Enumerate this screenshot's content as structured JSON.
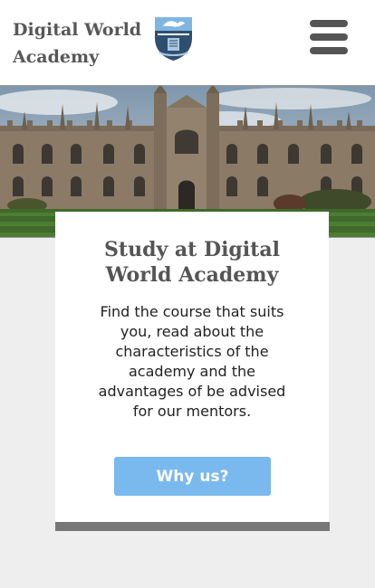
{
  "header": {
    "brand_name": "Digital World Academy",
    "logo_icon": "academy-crest-icon",
    "menu_icon": "hamburger-menu-icon"
  },
  "hero": {
    "image": "college-building-photo"
  },
  "card": {
    "title": "Study at Digital World Academy",
    "text": "Find the course that suits you, read about the characteristics of the academy and the advantages of be advised for our mentors.",
    "button_label": "Why us?"
  },
  "colors": {
    "accent": "#79b9ee",
    "text_heading": "#555555",
    "footer_bar": "#777777",
    "background": "#eeeeee"
  }
}
